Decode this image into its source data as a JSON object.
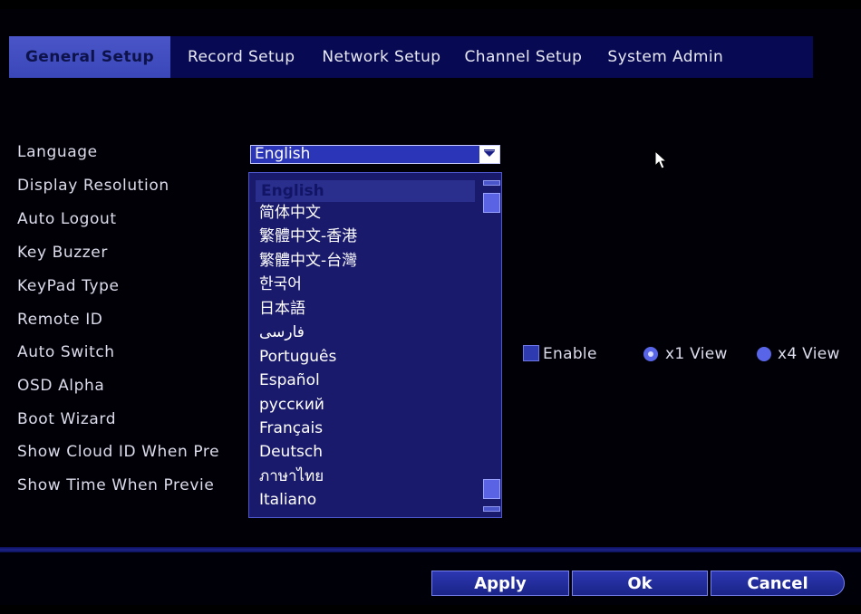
{
  "tabs": [
    {
      "label": "General Setup"
    },
    {
      "label": "Record Setup"
    },
    {
      "label": "Network Setup"
    },
    {
      "label": "Channel Setup"
    },
    {
      "label": "System Admin"
    }
  ],
  "active_tab": "General Setup",
  "settings": {
    "language": "Language",
    "display_resolution": "Display Resolution",
    "auto_logout": "Auto Logout",
    "key_buzzer": "Key Buzzer",
    "keypad_type": "KeyPad Type",
    "remote_id": "Remote ID",
    "auto_switch": "Auto Switch",
    "osd_alpha": "OSD Alpha",
    "boot_wizard": "Boot Wizard",
    "show_cloud_id": "Show Cloud ID When Pre",
    "show_time": "Show Time When Previe"
  },
  "language_select": {
    "value": "English",
    "options": [
      "English",
      "简体中文",
      "繁體中文-香港",
      "繁體中文-台灣",
      "한국어",
      "日本語",
      "فارسی",
      "Português",
      "Español",
      "русский",
      "Français",
      "Deutsch",
      "ภาษาไทย",
      "Italiano"
    ]
  },
  "auto_switch": {
    "enable_label": "Enable",
    "enabled": false,
    "view_x1_label": "x1 View",
    "view_x4_label": "x4 View",
    "selected_view": "x1 View"
  },
  "buttons": {
    "apply": "Apply",
    "ok": "Ok",
    "cancel": "Cancel"
  },
  "colors": {
    "accent": "#3a47b8",
    "tab_bar": "#070a52",
    "dropdown_bg": "#1a1a6c",
    "radio": "#5865e8"
  },
  "icons": {
    "dropdown_arrow": "chevron-down-icon",
    "mouse_cursor": "mouse-pointer-icon"
  }
}
